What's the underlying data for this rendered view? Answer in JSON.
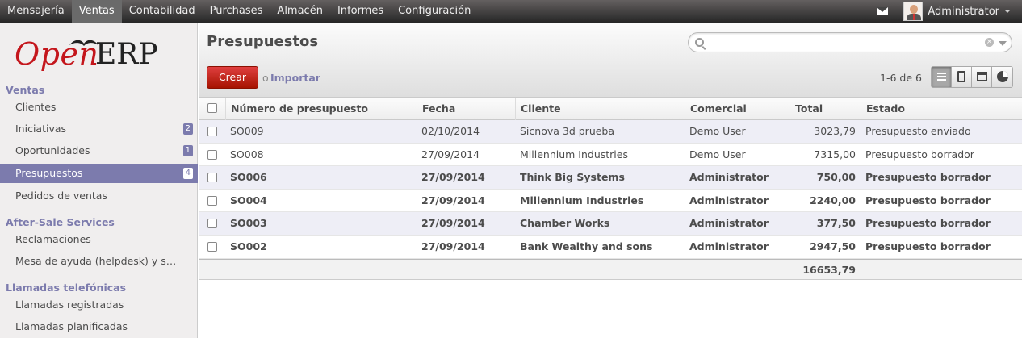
{
  "topmenu": [
    "Mensajería",
    "Ventas",
    "Contabilidad",
    "Purchases",
    "Almacén",
    "Informes",
    "Configuración"
  ],
  "user": {
    "name": "Administrator"
  },
  "logo": {
    "open": "Open",
    "erp": "ERP"
  },
  "sidebar": {
    "sections": [
      {
        "title": "Ventas",
        "items": [
          {
            "label": "Clientes",
            "badge": ""
          },
          {
            "label": "Iniciativas",
            "badge": "2"
          },
          {
            "label": "Oportunidades",
            "badge": "1"
          },
          {
            "label": "Presupuestos",
            "badge": "4",
            "active": true
          },
          {
            "label": "Pedidos de ventas",
            "badge": ""
          }
        ]
      },
      {
        "title": "After-Sale Services",
        "items": [
          {
            "label": "Reclamaciones",
            "badge": ""
          },
          {
            "label": "Mesa de ayuda (helpdesk) y s…",
            "badge": ""
          }
        ]
      },
      {
        "title": "Llamadas telefónicas",
        "items": [
          {
            "label": "Llamadas registradas",
            "badge": ""
          },
          {
            "label": "Llamadas planificadas",
            "badge": ""
          }
        ]
      }
    ]
  },
  "page": {
    "title": "Presupuestos",
    "search_placeholder": "",
    "create_label": "Crear",
    "or_label": "o",
    "import_label": "Importar",
    "pager": "1-6 de 6"
  },
  "table": {
    "columns": [
      "Número de presupuesto",
      "Fecha",
      "Cliente",
      "Comercial",
      "Total",
      "Estado"
    ],
    "rows": [
      {
        "number": "SO009",
        "date": "02/10/2014",
        "customer": "Sicnova 3d prueba",
        "salesperson": "Demo User",
        "total": "3023,79",
        "state": "Presupuesto enviado",
        "bold": false
      },
      {
        "number": "SO008",
        "date": "27/09/2014",
        "customer": "Millennium Industries",
        "salesperson": "Demo User",
        "total": "7315,00",
        "state": "Presupuesto borrador",
        "bold": false
      },
      {
        "number": "SO006",
        "date": "27/09/2014",
        "customer": "Think Big Systems",
        "salesperson": "Administrator",
        "total": "750,00",
        "state": "Presupuesto borrador",
        "bold": true
      },
      {
        "number": "SO004",
        "date": "27/09/2014",
        "customer": "Millennium Industries",
        "salesperson": "Administrator",
        "total": "2240,00",
        "state": "Presupuesto borrador",
        "bold": true
      },
      {
        "number": "SO003",
        "date": "27/09/2014",
        "customer": "Chamber Works",
        "salesperson": "Administrator",
        "total": "377,50",
        "state": "Presupuesto borrador",
        "bold": true
      },
      {
        "number": "SO002",
        "date": "27/09/2014",
        "customer": "Bank Wealthy and sons",
        "salesperson": "Administrator",
        "total": "2947,50",
        "state": "Presupuesto borrador",
        "bold": true
      }
    ],
    "sum_total": "16653,79"
  },
  "colors": {
    "accent": "#7c7bad",
    "create_button": "#c21f1f"
  }
}
